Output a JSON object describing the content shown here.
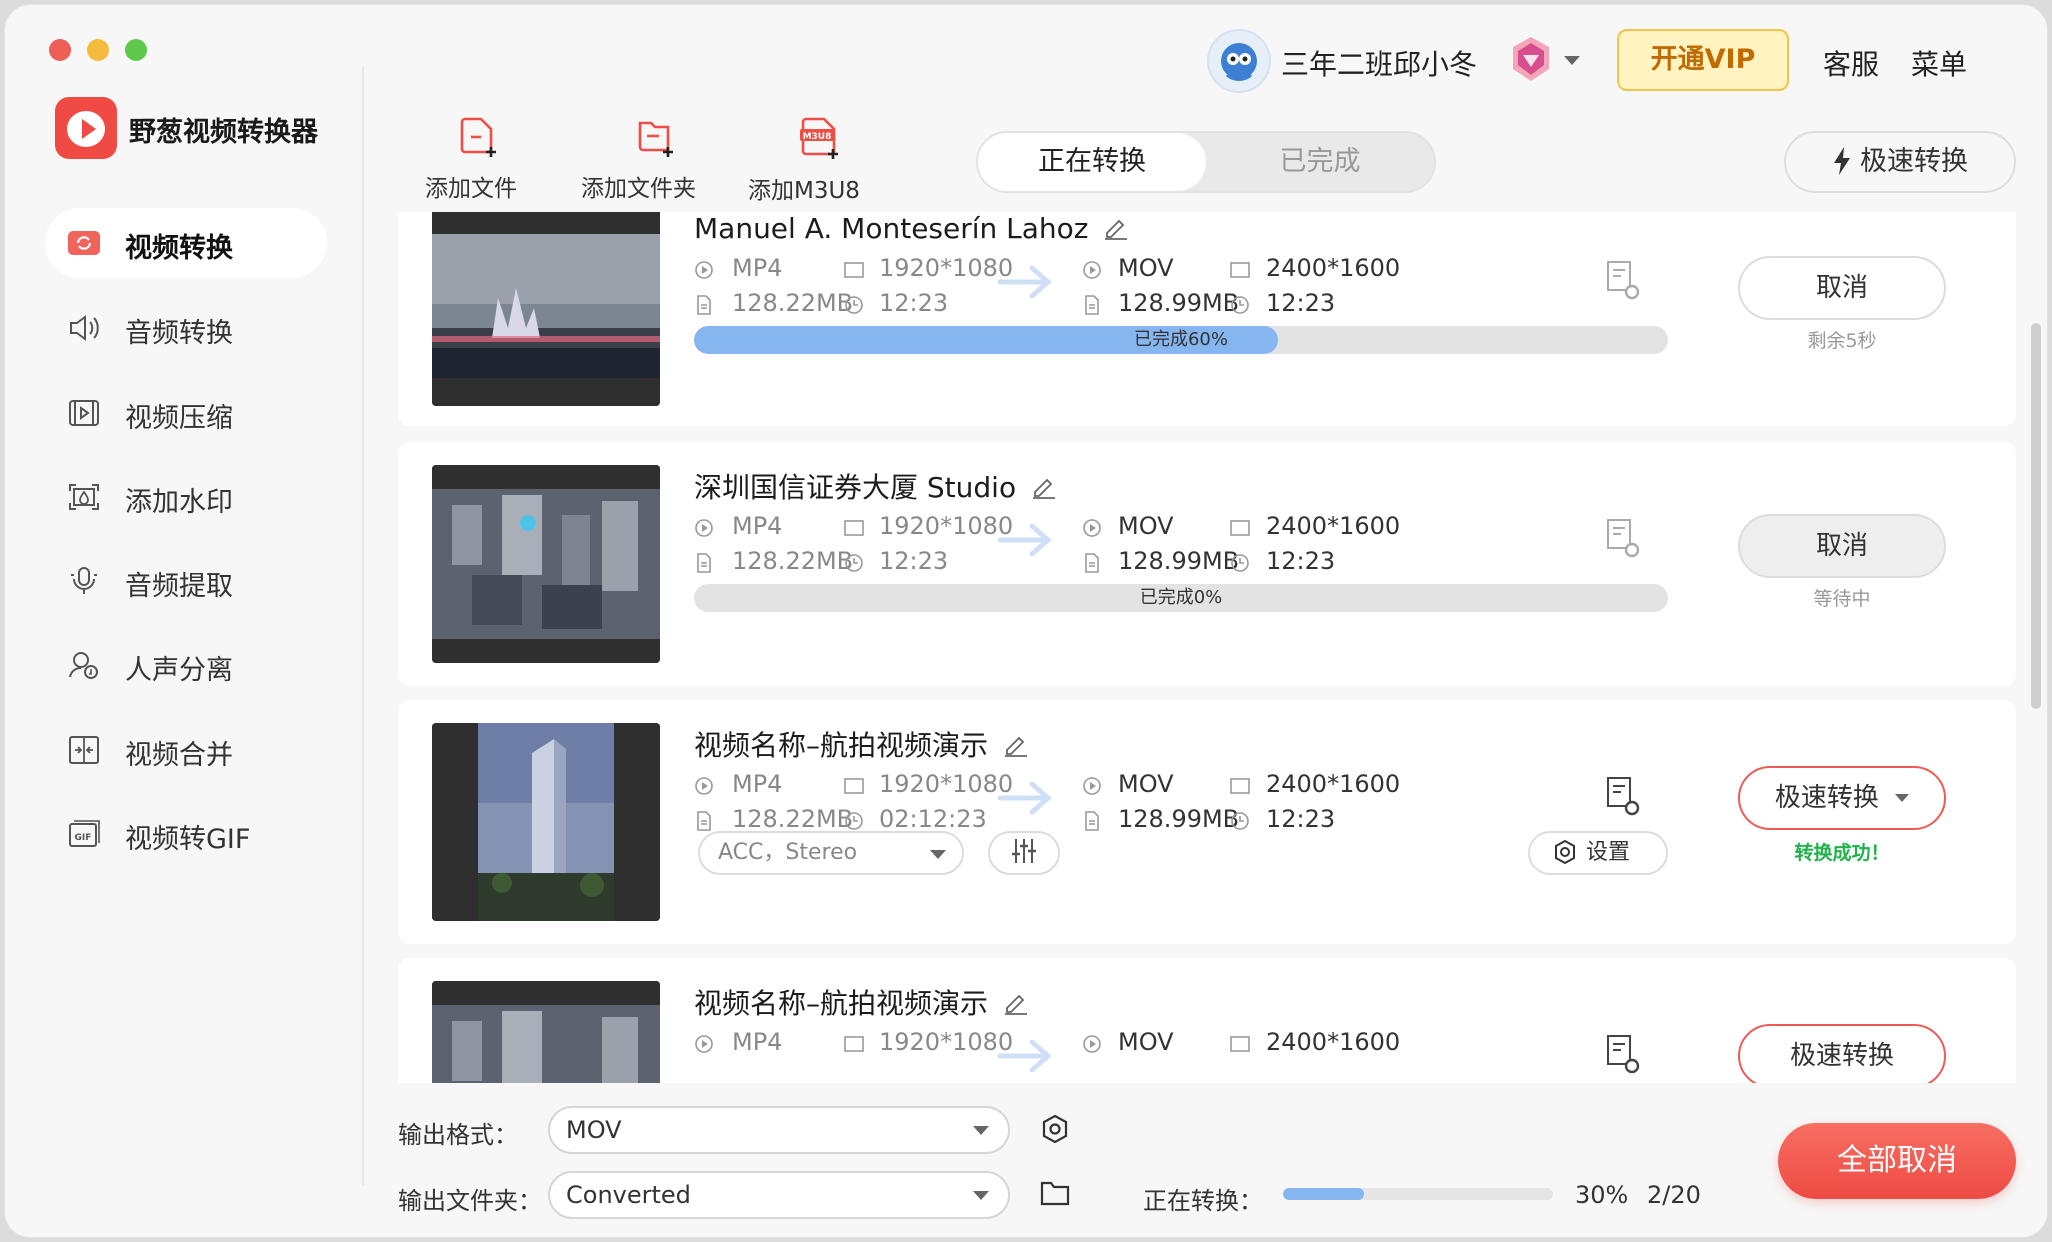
{
  "app": {
    "name": "野葱视频转换器"
  },
  "colors": {
    "accent_red": "#ef4e46",
    "progress_blue": "#86b6f0",
    "success_green": "#21b24a",
    "vip_gold": "#c06a00"
  },
  "header": {
    "user_name": "三年二班邱小冬",
    "vip_label": "开通VIP",
    "service_label": "客服",
    "menu_label": "菜单"
  },
  "sidebar": {
    "items": [
      {
        "label": "视频转换",
        "icon": "video-convert-icon",
        "active": true
      },
      {
        "label": "音频转换",
        "icon": "audio-icon"
      },
      {
        "label": "视频压缩",
        "icon": "compress-icon"
      },
      {
        "label": "添加水印",
        "icon": "watermark-icon"
      },
      {
        "label": "音频提取",
        "icon": "mic-icon"
      },
      {
        "label": "人声分离",
        "icon": "vocal-icon"
      },
      {
        "label": "视频合并",
        "icon": "merge-icon"
      },
      {
        "label": "视频转GIF",
        "icon": "gif-icon"
      }
    ]
  },
  "toolbar": {
    "add_file": "添加文件",
    "add_folder": "添加文件夹",
    "add_m3u8": "添加M3U8",
    "m3u8_badge": "M3U8",
    "fast_convert": "极速转换"
  },
  "tabs": {
    "converting": "正在转换",
    "done": "已完成"
  },
  "tasks": [
    {
      "title": "Manuel A. Monteserín Lahoz",
      "src_format": "MP4",
      "src_res": "1920*1080",
      "src_size": "128.22MB",
      "src_duration": "12:23",
      "dst_format": "MOV",
      "dst_res": "2400*1600",
      "dst_size": "128.99MB",
      "dst_duration": "12:23",
      "progress": 60,
      "progress_text": "已完成60%",
      "action": "取消",
      "status": "剩余5秒"
    },
    {
      "title": "深圳国信证券大厦  Studio",
      "src_format": "MP4",
      "src_res": "1920*1080",
      "src_size": "128.22MB",
      "src_duration": "12:23",
      "dst_format": "MOV",
      "dst_res": "2400*1600",
      "dst_size": "128.99MB",
      "dst_duration": "12:23",
      "progress": 0,
      "progress_text": "已完成0%",
      "action": "取消",
      "status": "等待中"
    },
    {
      "title": "视频名称–航拍视频演示",
      "src_format": "MP4",
      "src_res": "1920*1080",
      "src_size": "128.22MB",
      "src_duration": "02:12:23",
      "dst_format": "MOV",
      "dst_res": "2400*1600",
      "dst_size": "128.99MB",
      "dst_duration": "12:23",
      "audio_select": "ACC，Stereo",
      "settings_label": "设置",
      "action": "极速转换",
      "status": "转换成功！"
    },
    {
      "title": "视频名称–航拍视频演示",
      "src_format": "MP4",
      "src_res": "1920*1080",
      "dst_format": "MOV",
      "dst_res": "2400*1600",
      "action": "极速转换"
    }
  ],
  "bottom": {
    "output_format_label": "输出格式：",
    "output_format_value": "MOV",
    "output_folder_label": "输出文件夹：",
    "output_folder_value": "Converted",
    "converting_label": "正在转换：",
    "overall_progress": 30,
    "overall_percent": "30%",
    "count": "2/20",
    "cancel_all": "全部取消"
  }
}
